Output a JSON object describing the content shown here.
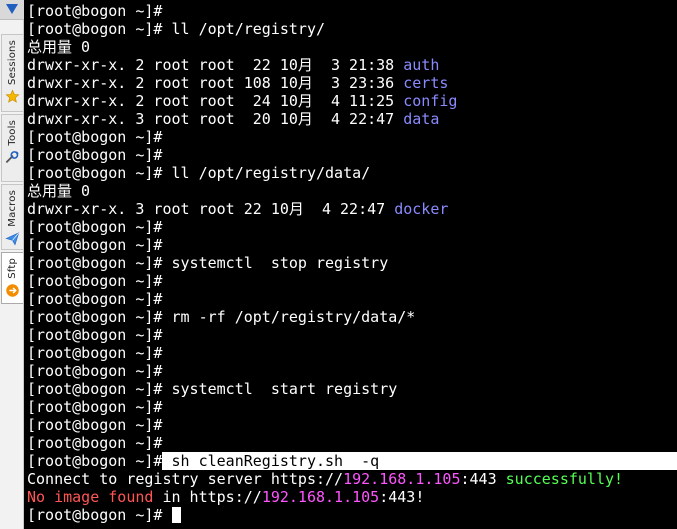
{
  "sidebar": {
    "tabs": [
      {
        "label": "Sessions",
        "icon": "star-icon"
      },
      {
        "label": "Tools",
        "icon": "tools-icon"
      },
      {
        "label": "Macros",
        "icon": "paper-plane-icon"
      },
      {
        "label": "Sftp",
        "icon": "sftp-icon"
      }
    ]
  },
  "terminal": {
    "prompt": "[root@bogon ~]#",
    "cmd_ll_registry": " ll /opt/registry/",
    "total_label": "总用量 0",
    "registry_listing": [
      {
        "meta": "drwxr-xr-x. 2 root root  22 10月  3 21:38 ",
        "name": "auth"
      },
      {
        "meta": "drwxr-xr-x. 2 root root 108 10月  3 23:36 ",
        "name": "certs"
      },
      {
        "meta": "drwxr-xr-x. 2 root root  24 10月  4 11:25 ",
        "name": "config"
      },
      {
        "meta": "drwxr-xr-x. 3 root root  20 10月  4 22:47 ",
        "name": "data"
      }
    ],
    "cmd_ll_data": " ll /opt/registry/data/",
    "data_listing": [
      {
        "meta": "drwxr-xr-x. 3 root root 22 10月  4 22:47 ",
        "name": "docker"
      }
    ],
    "cmd_stop": " systemctl  stop registry",
    "cmd_rm": " rm -rf /opt/registry/data/*",
    "cmd_start": " systemctl  start registry",
    "cmd_clean": " sh cleanRegistry.sh  -q",
    "out1": {
      "prefix": "Connect to registry server https://",
      "ip": "192.168.1.105",
      "port": ":443 ",
      "status": "successfully!"
    },
    "out2": {
      "prefix": "No image found",
      "mid": " in https://",
      "ip": "192.168.1.105",
      "suffix": ":443!"
    }
  }
}
